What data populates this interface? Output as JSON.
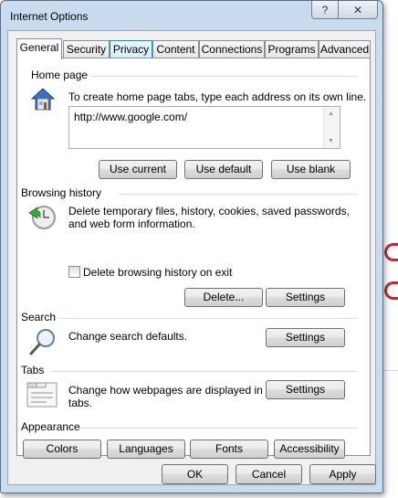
{
  "window": {
    "title": "Internet Options",
    "help_glyph": "?",
    "close_glyph": "✕"
  },
  "tabs": [
    {
      "label": "General",
      "selected": true
    },
    {
      "label": "Security"
    },
    {
      "label": "Privacy",
      "hover": true
    },
    {
      "label": "Content"
    },
    {
      "label": "Connections"
    },
    {
      "label": "Programs"
    },
    {
      "label": "Advanced"
    }
  ],
  "home_page": {
    "heading": "Home page",
    "description": "To create home page tabs, type each address on its own line.",
    "url": "http://www.google.com/",
    "use_current": "Use current",
    "use_default": "Use default",
    "use_blank": "Use blank",
    "icon": "house-icon"
  },
  "browsing_history": {
    "heading": "Browsing history",
    "description_line1": "Delete temporary files, history, cookies, saved passwords,",
    "description_line2": "and web form information.",
    "checkbox_label": "Delete browsing history on exit",
    "checkbox_checked": false,
    "delete_button": "Delete...",
    "settings_button": "Settings",
    "icon": "history-clock-icon"
  },
  "search": {
    "heading": "Search",
    "description": "Change search defaults.",
    "settings_button": "Settings",
    "icon": "magnifier-icon"
  },
  "tabs_section": {
    "heading": "Tabs",
    "description_line1": "Change how webpages are displayed in",
    "description_line2": "tabs.",
    "settings_button": "Settings",
    "icon": "tabbed-window-icon"
  },
  "appearance": {
    "heading": "Appearance",
    "colors": "Colors",
    "languages": "Languages",
    "fonts": "Fonts",
    "accessibility": "Accessibility"
  },
  "footer": {
    "ok": "OK",
    "cancel": "Cancel",
    "apply": "Apply"
  },
  "colors": {
    "window_frame": "#c9dcef",
    "client": "#f0f0f0",
    "tab_hover": "#d7effc",
    "accent_red": "#c8262e"
  }
}
